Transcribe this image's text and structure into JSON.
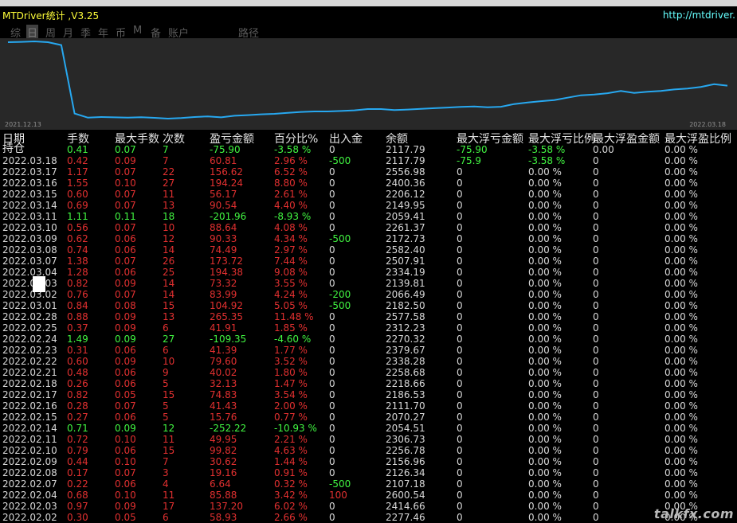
{
  "app": {
    "title": "MTDriver统计 ,V3.25",
    "url": "http://mtdriver."
  },
  "tabs": [
    {
      "label": "综",
      "active": false
    },
    {
      "label": "日",
      "active": true
    },
    {
      "label": "周",
      "active": false
    },
    {
      "label": "月",
      "active": false
    },
    {
      "label": "季",
      "active": false
    },
    {
      "label": "年",
      "active": false
    },
    {
      "label": "币",
      "active": false
    },
    {
      "label": "M",
      "active": false
    },
    {
      "label": "备",
      "active": false
    },
    {
      "label": "账户",
      "active": false
    },
    {
      "label": "路径",
      "active": false
    }
  ],
  "chart_data": {
    "type": "line",
    "x_start": "2021.12.13",
    "x_end": "2022.03.18",
    "line_color": "#27a8f0",
    "background": "#282828",
    "values": [
      2480,
      2482,
      2485,
      2480,
      2462,
      2030,
      2004,
      2008,
      2006,
      2004,
      2007,
      2003,
      1998,
      2002,
      2008,
      2012,
      2006,
      2016,
      2020,
      2025,
      2028,
      2034,
      2040,
      2043,
      2043,
      2046,
      2050,
      2058,
      2058,
      2052,
      2055,
      2060,
      2064,
      2068,
      2072,
      2075,
      2070,
      2073,
      2090,
      2100,
      2108,
      2115,
      2130,
      2145,
      2150,
      2158,
      2172,
      2160,
      2167,
      2172,
      2182,
      2188,
      2198,
      2215,
      2206
    ]
  },
  "table": {
    "headers": [
      "日期",
      "手数",
      "最大手数",
      "次数",
      "盈亏金额",
      "百分比%",
      "出入金",
      "余额",
      "最大浮亏金额",
      "最大浮亏比例",
      "最大浮盈金额",
      "最大浮盈比例"
    ],
    "holding": {
      "date": "持仓",
      "lots": "0.41",
      "max_lots": "0.07",
      "count": "7",
      "pl": "-75.90",
      "pct": "-3.58 %",
      "flow": "0",
      "balance": "2117.79",
      "max_float_loss": "-75.90",
      "max_float_loss_pct": "-3.58 %",
      "max_float_profit": "0.00",
      "max_float_profit_pct": "0.00 %",
      "tone": "green"
    },
    "rows": [
      {
        "date": "2022.03.18",
        "lots": "0.42",
        "max_lots": "0.09",
        "count": "7",
        "pl": "60.81",
        "pct": "2.96 %",
        "flow": "-500",
        "balance": "2117.79",
        "max_float_loss": "-75.9",
        "max_float_loss_pct": "-3.58 %",
        "max_float_profit": "0",
        "max_float_profit_pct": "0.00 %",
        "tone": "red"
      },
      {
        "date": "2022.03.17",
        "lots": "1.17",
        "max_lots": "0.07",
        "count": "22",
        "pl": "156.62",
        "pct": "6.52 %",
        "flow": "0",
        "balance": "2556.98",
        "max_float_loss": "0",
        "max_float_loss_pct": "0.00 %",
        "max_float_profit": "0",
        "max_float_profit_pct": "0.00 %",
        "tone": "red"
      },
      {
        "date": "2022.03.16",
        "lots": "1.55",
        "max_lots": "0.10",
        "count": "27",
        "pl": "194.24",
        "pct": "8.80 %",
        "flow": "0",
        "balance": "2400.36",
        "max_float_loss": "0",
        "max_float_loss_pct": "0.00 %",
        "max_float_profit": "0",
        "max_float_profit_pct": "0.00 %",
        "tone": "red"
      },
      {
        "date": "2022.03.15",
        "lots": "0.60",
        "max_lots": "0.07",
        "count": "11",
        "pl": "56.17",
        "pct": "2.61 %",
        "flow": "0",
        "balance": "2206.12",
        "max_float_loss": "0",
        "max_float_loss_pct": "0.00 %",
        "max_float_profit": "0",
        "max_float_profit_pct": "0.00 %",
        "tone": "red"
      },
      {
        "date": "2022.03.14",
        "lots": "0.69",
        "max_lots": "0.07",
        "count": "13",
        "pl": "90.54",
        "pct": "4.40 %",
        "flow": "0",
        "balance": "2149.95",
        "max_float_loss": "0",
        "max_float_loss_pct": "0.00 %",
        "max_float_profit": "0",
        "max_float_profit_pct": "0.00 %",
        "tone": "red"
      },
      {
        "date": "2022.03.11",
        "lots": "1.11",
        "max_lots": "0.11",
        "count": "18",
        "pl": "-201.96",
        "pct": "-8.93 %",
        "flow": "0",
        "balance": "2059.41",
        "max_float_loss": "0",
        "max_float_loss_pct": "0.00 %",
        "max_float_profit": "0",
        "max_float_profit_pct": "0.00 %",
        "tone": "green"
      },
      {
        "date": "2022.03.10",
        "lots": "0.56",
        "max_lots": "0.07",
        "count": "10",
        "pl": "88.64",
        "pct": "4.08 %",
        "flow": "0",
        "balance": "2261.37",
        "max_float_loss": "0",
        "max_float_loss_pct": "0.00 %",
        "max_float_profit": "0",
        "max_float_profit_pct": "0.00 %",
        "tone": "red"
      },
      {
        "date": "2022.03.09",
        "lots": "0.62",
        "max_lots": "0.06",
        "count": "12",
        "pl": "90.33",
        "pct": "4.34 %",
        "flow": "-500",
        "balance": "2172.73",
        "max_float_loss": "0",
        "max_float_loss_pct": "0.00 %",
        "max_float_profit": "0",
        "max_float_profit_pct": "0.00 %",
        "tone": "red"
      },
      {
        "date": "2022.03.08",
        "lots": "0.74",
        "max_lots": "0.06",
        "count": "14",
        "pl": "74.49",
        "pct": "2.97 %",
        "flow": "0",
        "balance": "2582.40",
        "max_float_loss": "0",
        "max_float_loss_pct": "0.00 %",
        "max_float_profit": "0",
        "max_float_profit_pct": "0.00 %",
        "tone": "red"
      },
      {
        "date": "2022.03.07",
        "lots": "1.38",
        "max_lots": "0.07",
        "count": "26",
        "pl": "173.72",
        "pct": "7.44 %",
        "flow": "0",
        "balance": "2507.91",
        "max_float_loss": "0",
        "max_float_loss_pct": "0.00 %",
        "max_float_profit": "0",
        "max_float_profit_pct": "0.00 %",
        "tone": "red"
      },
      {
        "date": "2022.03.04",
        "lots": "1.28",
        "max_lots": "0.06",
        "count": "25",
        "pl": "194.38",
        "pct": "9.08 %",
        "flow": "0",
        "balance": "2334.19",
        "max_float_loss": "0",
        "max_float_loss_pct": "0.00 %",
        "max_float_profit": "0",
        "max_float_profit_pct": "0.00 %",
        "tone": "red"
      },
      {
        "date": "2022.03.03",
        "lots": "0.82",
        "max_lots": "0.09",
        "count": "14",
        "pl": "73.32",
        "pct": "3.55 %",
        "flow": "0",
        "balance": "2139.81",
        "max_float_loss": "0",
        "max_float_loss_pct": "0.00 %",
        "max_float_profit": "0",
        "max_float_profit_pct": "0.00 %",
        "tone": "red"
      },
      {
        "date": "2022.03.02",
        "lots": "0.76",
        "max_lots": "0.07",
        "count": "14",
        "pl": "83.99",
        "pct": "4.24 %",
        "flow": "-200",
        "balance": "2066.49",
        "max_float_loss": "0",
        "max_float_loss_pct": "0.00 %",
        "max_float_profit": "0",
        "max_float_profit_pct": "0.00 %",
        "tone": "red"
      },
      {
        "date": "2022.03.01",
        "lots": "0.84",
        "max_lots": "0.08",
        "count": "15",
        "pl": "104.92",
        "pct": "5.05 %",
        "flow": "-500",
        "balance": "2182.50",
        "max_float_loss": "0",
        "max_float_loss_pct": "0.00 %",
        "max_float_profit": "0",
        "max_float_profit_pct": "0.00 %",
        "tone": "red"
      },
      {
        "date": "2022.02.28",
        "lots": "0.88",
        "max_lots": "0.09",
        "count": "13",
        "pl": "265.35",
        "pct": "11.48 %",
        "flow": "0",
        "balance": "2577.58",
        "max_float_loss": "0",
        "max_float_loss_pct": "0.00 %",
        "max_float_profit": "0",
        "max_float_profit_pct": "0.00 %",
        "tone": "red"
      },
      {
        "date": "2022.02.25",
        "lots": "0.37",
        "max_lots": "0.09",
        "count": "6",
        "pl": "41.91",
        "pct": "1.85 %",
        "flow": "0",
        "balance": "2312.23",
        "max_float_loss": "0",
        "max_float_loss_pct": "0.00 %",
        "max_float_profit": "0",
        "max_float_profit_pct": "0.00 %",
        "tone": "red"
      },
      {
        "date": "2022.02.24",
        "lots": "1.49",
        "max_lots": "0.09",
        "count": "27",
        "pl": "-109.35",
        "pct": "-4.60 %",
        "flow": "0",
        "balance": "2270.32",
        "max_float_loss": "0",
        "max_float_loss_pct": "0.00 %",
        "max_float_profit": "0",
        "max_float_profit_pct": "0.00 %",
        "tone": "green"
      },
      {
        "date": "2022.02.23",
        "lots": "0.31",
        "max_lots": "0.06",
        "count": "6",
        "pl": "41.39",
        "pct": "1.77 %",
        "flow": "0",
        "balance": "2379.67",
        "max_float_loss": "0",
        "max_float_loss_pct": "0.00 %",
        "max_float_profit": "0",
        "max_float_profit_pct": "0.00 %",
        "tone": "red"
      },
      {
        "date": "2022.02.22",
        "lots": "0.60",
        "max_lots": "0.09",
        "count": "10",
        "pl": "79.60",
        "pct": "3.52 %",
        "flow": "0",
        "balance": "2338.28",
        "max_float_loss": "0",
        "max_float_loss_pct": "0.00 %",
        "max_float_profit": "0",
        "max_float_profit_pct": "0.00 %",
        "tone": "red"
      },
      {
        "date": "2022.02.21",
        "lots": "0.48",
        "max_lots": "0.06",
        "count": "9",
        "pl": "40.02",
        "pct": "1.80 %",
        "flow": "0",
        "balance": "2258.68",
        "max_float_loss": "0",
        "max_float_loss_pct": "0.00 %",
        "max_float_profit": "0",
        "max_float_profit_pct": "0.00 %",
        "tone": "red"
      },
      {
        "date": "2022.02.18",
        "lots": "0.26",
        "max_lots": "0.06",
        "count": "5",
        "pl": "32.13",
        "pct": "1.47 %",
        "flow": "0",
        "balance": "2218.66",
        "max_float_loss": "0",
        "max_float_loss_pct": "0.00 %",
        "max_float_profit": "0",
        "max_float_profit_pct": "0.00 %",
        "tone": "red"
      },
      {
        "date": "2022.02.17",
        "lots": "0.82",
        "max_lots": "0.05",
        "count": "15",
        "pl": "74.83",
        "pct": "3.54 %",
        "flow": "0",
        "balance": "2186.53",
        "max_float_loss": "0",
        "max_float_loss_pct": "0.00 %",
        "max_float_profit": "0",
        "max_float_profit_pct": "0.00 %",
        "tone": "red"
      },
      {
        "date": "2022.02.16",
        "lots": "0.28",
        "max_lots": "0.07",
        "count": "5",
        "pl": "41.43",
        "pct": "2.00 %",
        "flow": "0",
        "balance": "2111.70",
        "max_float_loss": "0",
        "max_float_loss_pct": "0.00 %",
        "max_float_profit": "0",
        "max_float_profit_pct": "0.00 %",
        "tone": "red"
      },
      {
        "date": "2022.02.15",
        "lots": "0.27",
        "max_lots": "0.06",
        "count": "5",
        "pl": "15.76",
        "pct": "0.77 %",
        "flow": "0",
        "balance": "2070.27",
        "max_float_loss": "0",
        "max_float_loss_pct": "0.00 %",
        "max_float_profit": "0",
        "max_float_profit_pct": "0.00 %",
        "tone": "red"
      },
      {
        "date": "2022.02.14",
        "lots": "0.71",
        "max_lots": "0.09",
        "count": "12",
        "pl": "-252.22",
        "pct": "-10.93 %",
        "flow": "0",
        "balance": "2054.51",
        "max_float_loss": "0",
        "max_float_loss_pct": "0.00 %",
        "max_float_profit": "0",
        "max_float_profit_pct": "0.00 %",
        "tone": "green"
      },
      {
        "date": "2022.02.11",
        "lots": "0.72",
        "max_lots": "0.10",
        "count": "11",
        "pl": "49.95",
        "pct": "2.21 %",
        "flow": "0",
        "balance": "2306.73",
        "max_float_loss": "0",
        "max_float_loss_pct": "0.00 %",
        "max_float_profit": "0",
        "max_float_profit_pct": "0.00 %",
        "tone": "red"
      },
      {
        "date": "2022.02.10",
        "lots": "0.79",
        "max_lots": "0.06",
        "count": "15",
        "pl": "99.82",
        "pct": "4.63 %",
        "flow": "0",
        "balance": "2256.78",
        "max_float_loss": "0",
        "max_float_loss_pct": "0.00 %",
        "max_float_profit": "0",
        "max_float_profit_pct": "0.00 %",
        "tone": "red"
      },
      {
        "date": "2022.02.09",
        "lots": "0.44",
        "max_lots": "0.10",
        "count": "7",
        "pl": "30.62",
        "pct": "1.44 %",
        "flow": "0",
        "balance": "2156.96",
        "max_float_loss": "0",
        "max_float_loss_pct": "0.00 %",
        "max_float_profit": "0",
        "max_float_profit_pct": "0.00 %",
        "tone": "red"
      },
      {
        "date": "2022.02.08",
        "lots": "0.17",
        "max_lots": "0.07",
        "count": "3",
        "pl": "19.16",
        "pct": "0.91 %",
        "flow": "0",
        "balance": "2126.34",
        "max_float_loss": "0",
        "max_float_loss_pct": "0.00 %",
        "max_float_profit": "0",
        "max_float_profit_pct": "0.00 %",
        "tone": "red"
      },
      {
        "date": "2022.02.07",
        "lots": "0.22",
        "max_lots": "0.06",
        "count": "4",
        "pl": "6.64",
        "pct": "0.32 %",
        "flow": "-500",
        "balance": "2107.18",
        "max_float_loss": "0",
        "max_float_loss_pct": "0.00 %",
        "max_float_profit": "0",
        "max_float_profit_pct": "0.00 %",
        "tone": "red"
      },
      {
        "date": "2022.02.04",
        "lots": "0.68",
        "max_lots": "0.10",
        "count": "11",
        "pl": "85.88",
        "pct": "3.42 %",
        "flow": "100",
        "balance": "2600.54",
        "max_float_loss": "0",
        "max_float_loss_pct": "0.00 %",
        "max_float_profit": "0",
        "max_float_profit_pct": "0.00 %",
        "tone": "red"
      },
      {
        "date": "2022.02.03",
        "lots": "0.97",
        "max_lots": "0.09",
        "count": "17",
        "pl": "137.20",
        "pct": "6.02 %",
        "flow": "0",
        "balance": "2414.66",
        "max_float_loss": "0",
        "max_float_loss_pct": "0.00 %",
        "max_float_profit": "0",
        "max_float_profit_pct": "0.00 %",
        "tone": "red"
      },
      {
        "date": "2022.02.02",
        "lots": "0.30",
        "max_lots": "0.05",
        "count": "6",
        "pl": "58.93",
        "pct": "2.66 %",
        "flow": "0",
        "balance": "2277.46",
        "max_float_loss": "0",
        "max_float_loss_pct": "0.00 %",
        "max_float_profit": "0",
        "max_float_profit_pct": "0.00 %",
        "tone": "red"
      }
    ]
  },
  "watermark": "talkfx.com"
}
